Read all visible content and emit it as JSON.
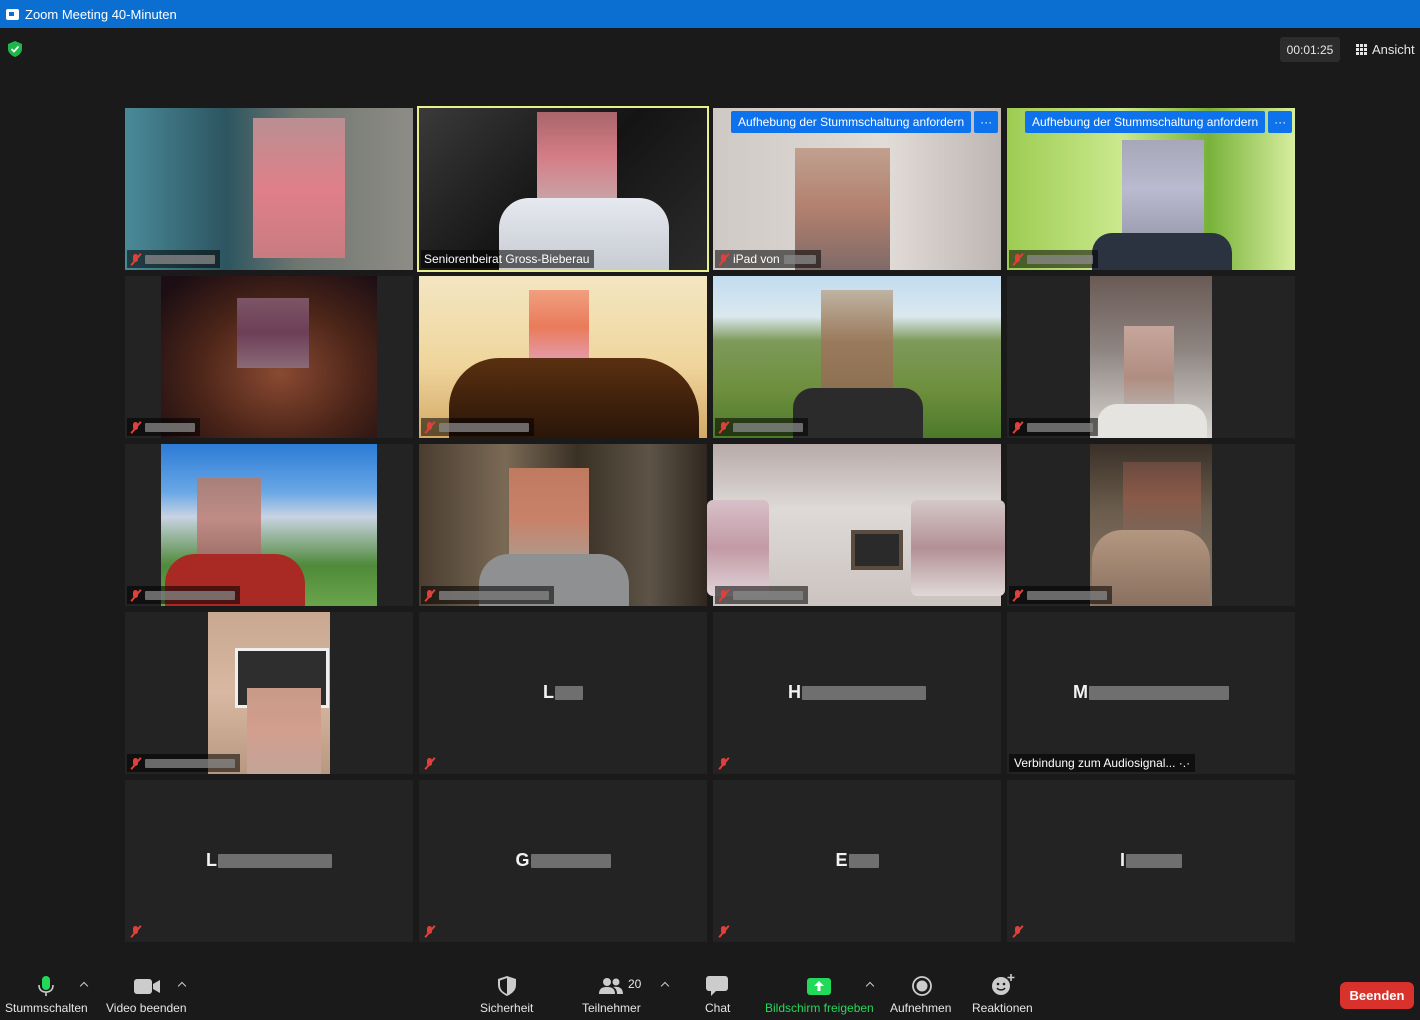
{
  "window": {
    "title": "Zoom Meeting 40-Minuten"
  },
  "header": {
    "timer": "00:01:25",
    "view_label": "Ansicht"
  },
  "tiles": [
    {
      "name": "",
      "kind": "video",
      "muted": true
    },
    {
      "name": "Seniorenbeirat Gross-Bieberau",
      "kind": "video",
      "muted": false,
      "active_speaker": true
    },
    {
      "name": "iPad von",
      "kind": "video",
      "muted": true,
      "request_unmute": "Aufhebung der Stummschaltung anfordern",
      "more": "···"
    },
    {
      "name": "",
      "kind": "video",
      "muted": true,
      "request_unmute": "Aufhebung der Stummschaltung anfordern",
      "more": "···"
    },
    {
      "name": "",
      "kind": "video",
      "muted": true
    },
    {
      "name": "",
      "kind": "video",
      "muted": true
    },
    {
      "name": "",
      "kind": "video",
      "muted": true
    },
    {
      "name": "",
      "kind": "video",
      "muted": true
    },
    {
      "name": "",
      "kind": "video",
      "muted": true
    },
    {
      "name": "",
      "kind": "video",
      "muted": true
    },
    {
      "name": "",
      "kind": "video",
      "muted": true
    },
    {
      "name": "",
      "kind": "video",
      "muted": true
    },
    {
      "name": "",
      "kind": "video",
      "muted": true
    },
    {
      "name": "L",
      "kind": "name_only",
      "muted": true
    },
    {
      "name": "H",
      "kind": "name_only",
      "muted": true
    },
    {
      "name": "M",
      "kind": "name_only",
      "muted": false,
      "audio_status": "Verbindung zum Audiosignal... ·.·"
    },
    {
      "name": "L",
      "kind": "name_only",
      "muted": true
    },
    {
      "name": "G",
      "kind": "name_only",
      "muted": true
    },
    {
      "name": "E",
      "kind": "name_only",
      "muted": true
    },
    {
      "name": "I",
      "kind": "name_only",
      "muted": true
    }
  ],
  "toolbar": {
    "mute": "Stummschalten",
    "video": "Video beenden",
    "security": "Sicherheit",
    "participants": "Teilnehmer",
    "participants_count": "20",
    "chat": "Chat",
    "share": "Bildschirm freigeben",
    "record": "Aufnehmen",
    "reactions": "Reaktionen",
    "end": "Beenden"
  },
  "colors": {
    "titlebar": "#0b6fd1",
    "share_green": "#23d959",
    "end_red": "#d9322c",
    "active_outline": "#e8f08c",
    "request_blue": "#0e72ed"
  }
}
